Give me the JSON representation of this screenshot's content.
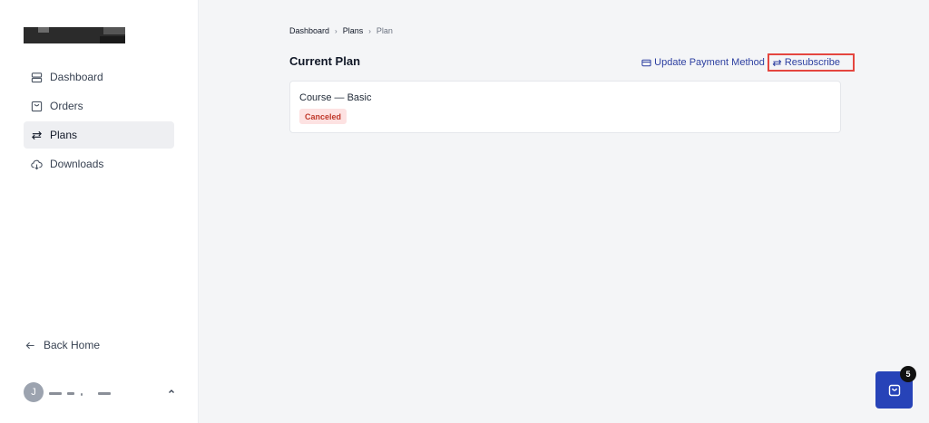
{
  "sidebar": {
    "items": [
      {
        "label": "Dashboard",
        "icon": "dashboard-icon"
      },
      {
        "label": "Orders",
        "icon": "orders-icon"
      },
      {
        "label": "Plans",
        "icon": "plans-icon"
      },
      {
        "label": "Downloads",
        "icon": "downloads-icon"
      }
    ],
    "back_home": "Back Home",
    "user_initial": "J"
  },
  "breadcrumb": {
    "items": [
      "Dashboard",
      "Plans",
      "Plan"
    ]
  },
  "main": {
    "title": "Current Plan",
    "update_payment_label": "Update Payment Method",
    "resubscribe_label": "Resubscribe",
    "plan": {
      "name": "Course — Basic",
      "status": "Canceled"
    }
  },
  "cart": {
    "count": "5"
  },
  "colors": {
    "accent": "#2c3fa0",
    "cart_bg": "#2743b8",
    "status_bg": "#fde2e2",
    "status_text": "#c0392b",
    "highlight_border": "#e5463f"
  }
}
